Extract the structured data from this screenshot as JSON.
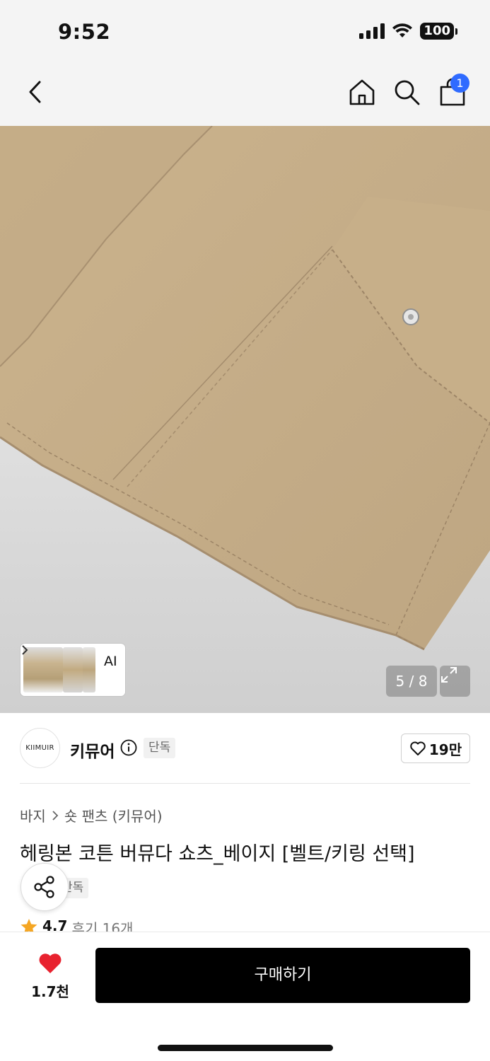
{
  "status_bar": {
    "time": "9:52",
    "battery": "100"
  },
  "nav": {
    "icons": [
      "back-icon",
      "home-icon",
      "search-icon",
      "shopping-bag-icon"
    ],
    "cart_badge": "1"
  },
  "gallery": {
    "ai_label": "AI",
    "counter": "5 / 8",
    "colors": {
      "fabric": "#c8b08a",
      "background": "#e2e2e2"
    }
  },
  "brand": {
    "logo_text": "KIIMUIR",
    "name": "키뮤어",
    "tag": "단독",
    "likes": "19만"
  },
  "product": {
    "breadcrumb": [
      "바지",
      "숏 팬츠 (키뮤어)"
    ],
    "title": "헤링본 코튼 버뮤다 쇼츠_베이지 [벨트/키링 선택]",
    "tag": "단독",
    "rating": "4.7",
    "reviews": "후기 16개"
  },
  "bottom": {
    "wish_count": "1.7천",
    "buy_label": "구매하기",
    "heart_color": "#e8222f"
  }
}
